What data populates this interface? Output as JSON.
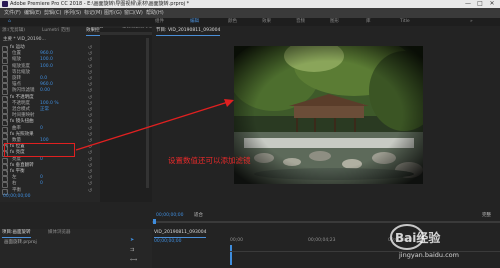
{
  "title_bar": {
    "title": "Adobe Premiere Pro CC 2018 - E:\\画面旋转\\导图视频\\素材\\画面旋转.prproj *",
    "minimize": "—",
    "maximize": "□",
    "close": "✕"
  },
  "menu": [
    "文件(F)",
    "编辑(E)",
    "剪辑(C)",
    "序列(S)",
    "标记(M)",
    "图形(G)",
    "窗口(W)",
    "帮助(H)"
  ],
  "workspaces": [
    "组件",
    "编辑",
    "颜色",
    "效果",
    "音频",
    "图形",
    "库",
    "Title"
  ],
  "left_panel": {
    "tabs": [
      "源:(无剪辑)",
      "Lumetri 范围",
      "效果控件",
      "音频剪辑混合器"
    ],
    "header": "主要 * VID_20190...",
    "rows": [
      {
        "label": "fx 运动",
        "value": ""
      },
      {
        "label": "位置",
        "value": "960.0"
      },
      {
        "label": "缩放",
        "value": "100.0"
      },
      {
        "label": "缩放宽度",
        "value": "100.0"
      },
      {
        "label": "等比缩放",
        "value": ""
      },
      {
        "label": "旋转",
        "value": "0.0"
      },
      {
        "label": "锚点",
        "value": "960.0"
      },
      {
        "label": "防闪烁滤镜",
        "value": "0.00"
      },
      {
        "label": "fx 不透明度",
        "value": ""
      },
      {
        "label": "不透明度",
        "value": "100.0 %"
      },
      {
        "label": "混合模式",
        "value": "正常"
      },
      {
        "label": "时间重映射",
        "value": ""
      },
      {
        "label": "fx 镜头扭曲",
        "value": ""
      },
      {
        "label": "曲率",
        "value": "0"
      },
      {
        "label": "fx 光照效果",
        "value": ""
      },
      {
        "label": "数量",
        "value": "100"
      },
      {
        "label": "fx 位置",
        "value": ""
      },
      {
        "label": "fx 亮度",
        "value": ""
      },
      {
        "label": "亮度",
        "value": "0"
      },
      {
        "label": "fx 垂直翻转",
        "value": ""
      },
      {
        "label": "fx 平衡",
        "value": ""
      },
      {
        "label": "左",
        "value": "0"
      },
      {
        "label": "右",
        "value": "0"
      },
      {
        "label": "平衡",
        "value": ""
      }
    ],
    "timecode": "00;00;00;00"
  },
  "monitor": {
    "tab": "节目: VID_20190811_093004",
    "timecode_left": "00;00;00;00",
    "zoom": "适合",
    "quality": "完整",
    "annotation": "设置数值还可以添加滤镜"
  },
  "lower_left": {
    "tabs": [
      "项目:画面旋转",
      "媒体浏览器"
    ],
    "item": "画面旋转.prproj"
  },
  "timeline": {
    "tab": "VID_20190811_093004",
    "timecode": "00;00;00;00",
    "marks": [
      "00;00",
      "00;00;04;23",
      "00;00;09;2"
    ]
  },
  "watermark": {
    "text": "Bai经验",
    "url": "jingyan.baidu.com"
  }
}
